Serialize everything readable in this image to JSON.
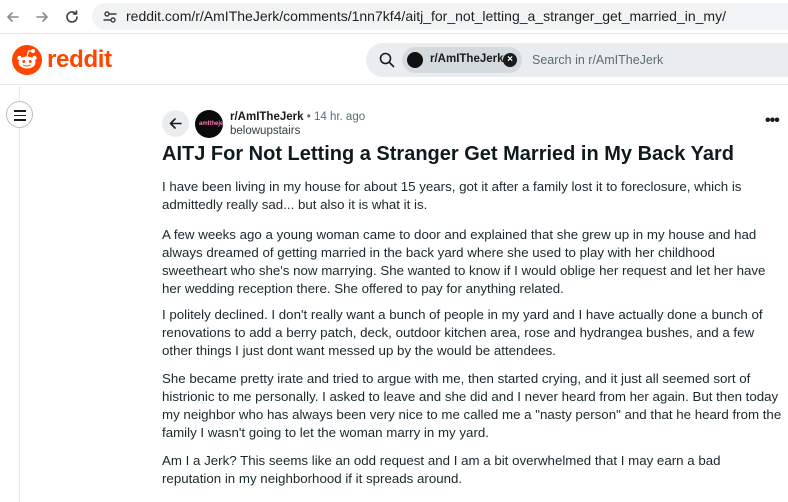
{
  "browser": {
    "url": "reddit.com/r/AmITheJerk/comments/1nn7kf4/aitj_for_not_letting_a_stranger_get_married_in_my/"
  },
  "header": {
    "logo_text": "reddit",
    "brand_color": "#ff4500",
    "search": {
      "chip_label": "r/AmITheJerk",
      "placeholder": "Search in r/AmITheJerk"
    }
  },
  "post": {
    "subreddit": "r/AmITheJerk",
    "separator": "•",
    "time": "14 hr. ago",
    "author": "belowupstairs",
    "more_label": "•••",
    "title": "AITJ For Not Letting a Stranger Get Married in My Back Yard",
    "paragraphs": [
      "I have been living in my house for about 15 years, got it after a family lost it to foreclosure, which is admittedly really sad... but also it is what it is.",
      "A few weeks ago a young woman came to door and explained that she grew up in my house and had always dreamed of getting married in the back yard where she used to play with her childhood sweetheart who she's now marrying. She wanted to know if I would oblige her request and let her have her wedding reception there. She offered to pay for anything related.",
      "I politely declined. I don't really want a bunch of people in my yard and I have actually done a bunch of renovations to add a berry patch, deck, outdoor kitchen area, rose and hydrangea bushes, and a few other things I just dont want messed up by the would be attendees.",
      "She became pretty irate and tried to argue with me, then started crying, and it just all seemed sort of histrionic to me personally. I asked to leave and she did and I never heard from her again. But then today my neighbor who has always been very nice to me called me a \"nasty person\" and that he heard from the family I wasn't going to let the woman marry in my yard.",
      "Am I a Jerk? This seems like an odd request and I am a bit overwhelmed that I may earn a bad reputation in my neighborhood if it spreads around."
    ]
  }
}
